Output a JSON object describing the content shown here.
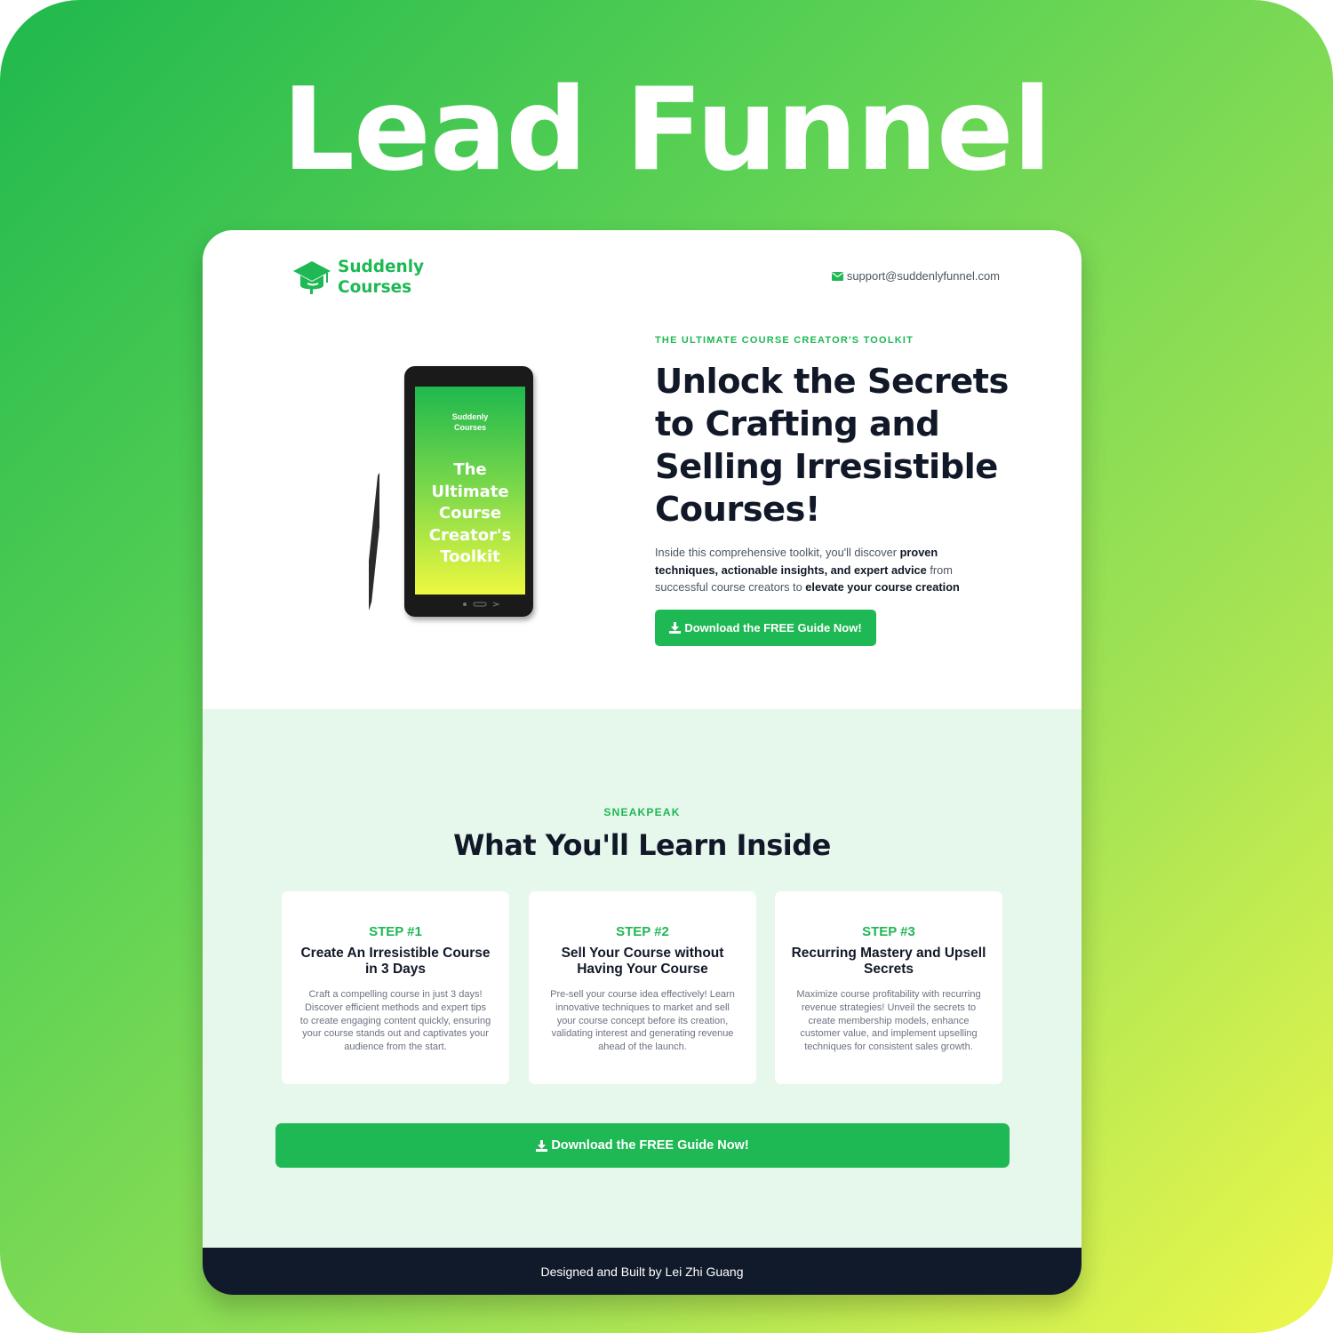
{
  "banner": {
    "title": "Lead Funnel"
  },
  "header": {
    "logo_line1": "Suddenly",
    "logo_line2": "Courses",
    "email": "support@suddenlyfunnel.com",
    "mail_icon": "envelope-icon"
  },
  "hero": {
    "eyebrow": "THE ULTIMATE COURSE CREATOR'S TOOLKIT",
    "headline": "Unlock the Secrets to Crafting and Selling Irresistible Courses!",
    "desc_part1": "Inside this comprehensive toolkit, you'll discover ",
    "desc_bold1": "proven techniques, actionable insights, and expert advice",
    "desc_part2": " from successful course creators to ",
    "desc_bold2": "elevate your course creation",
    "cta": "Download the FREE Guide Now!",
    "tablet": {
      "logo_line1": "Suddenly",
      "logo_line2": "Courses",
      "title": "The Ultimate Course Creator's Toolkit"
    }
  },
  "learn": {
    "eyebrow": "SNEAKPEAK",
    "title": "What You'll Learn Inside",
    "steps": [
      {
        "label": "STEP #1",
        "title": "Create An Irresistible Course in 3 Days",
        "desc": "Craft a compelling course in just 3 days! Discover efficient methods and expert tips to create engaging content quickly, ensuring your course stands out and captivates your audience from the start."
      },
      {
        "label": "STEP #2",
        "title": "Sell Your Course without Having Your Course",
        "desc": "Pre-sell your course idea effectively! Learn innovative techniques to market and sell your course concept before its creation, validating interest and generating revenue ahead of the launch."
      },
      {
        "label": "STEP #3",
        "title": "Recurring Mastery and Upsell Secrets",
        "desc": "Maximize course profitability with recurring revenue strategies! Unveil the secrets to create membership models, enhance customer value, and implement upselling techniques for consistent sales growth."
      }
    ],
    "cta": "Download the FREE Guide Now!"
  },
  "footer": {
    "text": "Designed and Built by Lei Zhi Guang"
  },
  "colors": {
    "accent": "#1eb854",
    "dark": "#111827",
    "footer_bg": "#111a2b",
    "section_bg": "#e6f7ec"
  }
}
